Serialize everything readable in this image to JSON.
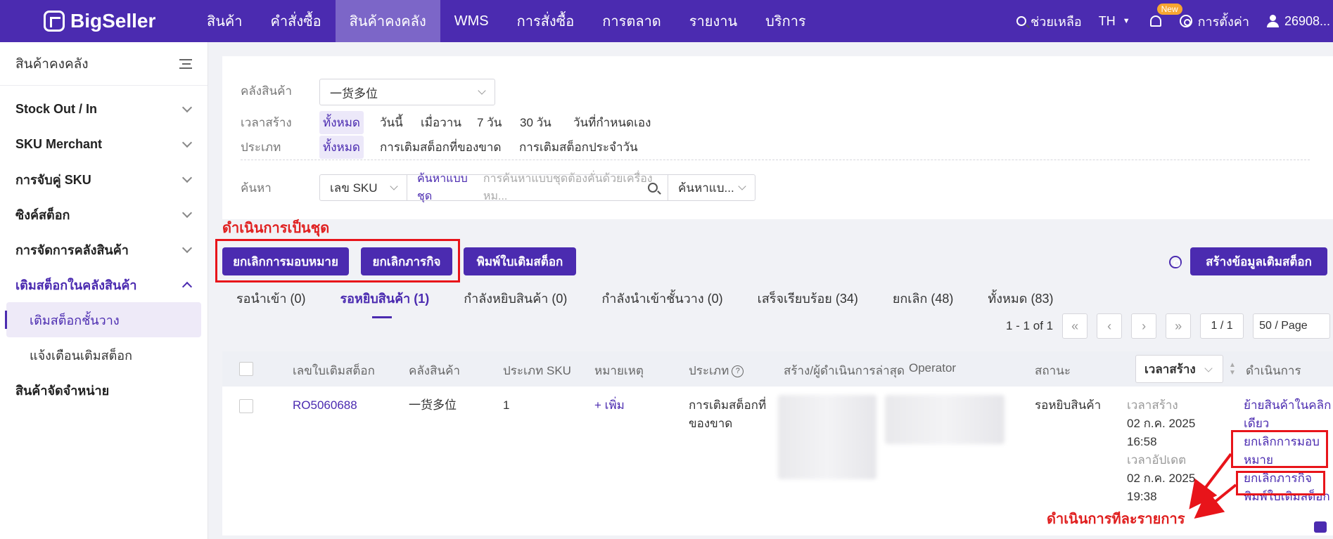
{
  "topbar": {
    "logo": "BigSeller",
    "nav": [
      "สินค้า",
      "คำสั่งซื้อ",
      "สินค้าคงคลัง",
      "WMS",
      "การสั่งซื้อ",
      "การตลาด",
      "รายงาน",
      "บริการ"
    ],
    "help": "ช่วยเหลือ",
    "lang": "TH",
    "new_badge": "New",
    "settings": "การตั้งค่า",
    "user": "26908..."
  },
  "sidebar": {
    "title": "สินค้าคงคลัง",
    "groups": [
      "Stock Out / In",
      "SKU Merchant",
      "การจับคู่ SKU",
      "ซิงค์สต็อก",
      "การจัดการคลังสินค้า",
      "เติมสต็อกในคลังสินค้า"
    ],
    "subitems": [
      "เติมสต็อกชั้นวาง",
      "แจ้งเตือนเติมสต็อก"
    ],
    "last_group": "สินค้าจัดจำหน่าย"
  },
  "filter": {
    "warehouse_label": "คลังสินค้า",
    "warehouse_value": "一货多位",
    "time_label": "เวลาสร้าง",
    "time_options": [
      "ทั้งหมด",
      "วันนี้",
      "เมื่อวาน",
      "7 วัน",
      "30 วัน",
      "วันที่กำหนดเอง"
    ],
    "type_label": "ประเภท",
    "type_options": [
      "ทั้งหมด",
      "การเติมสต็อกที่ของขาด",
      "การเติมสต็อกประจำวัน"
    ],
    "search_label": "ค้นหา",
    "search_field": "เลข SKU",
    "search_mode": "ค้นหาแบบชุด",
    "search_placeholder": "การค้นหาแบบชุดต้องคั่นด้วยเครื่องหม...",
    "search_scope": "ค้นหาแบ..."
  },
  "batch_label": "ดำเนินการเป็นชุด",
  "buttons": {
    "cancel_assign": "ยกเลิกการมอบหมาย",
    "cancel_task": "ยกเลิกภารกิจ",
    "print": "พิมพ์ใบเติมสต็อก",
    "create": "สร้างข้อมูลเติมสต็อก"
  },
  "tabs": [
    "รอนำเข้า (0)",
    "รอหยิบสินค้า (1)",
    "กำลังหยิบสินค้า (0)",
    "กำลังนำเข้าชั้นวาง (0)",
    "เสร็จเรียบร้อย (34)",
    "ยกเลิก (48)",
    "ทั้งหมด (83)"
  ],
  "pager": {
    "range": "1 - 1 of 1",
    "page": "1 / 1",
    "size": "50 / Page"
  },
  "table": {
    "headers": [
      "เลขใบเติมสต็อก",
      "คลังสินค้า",
      "ประเภท SKU",
      "หมายเหตุ",
      "ประเภท",
      "สร้าง/ผู้ดำเนินการล่าสุด",
      "Operator",
      "สถานะ",
      "เวลาสร้าง",
      "ดำเนินการ"
    ],
    "row": {
      "id": "RO5060688",
      "warehouse": "一货多位",
      "sku_type": "1",
      "note": "+ เพิ่ม",
      "type": "การเติมสต็อกที่ของขาด",
      "status": "รอหยิบสินค้า",
      "created_label": "เวลาสร้าง",
      "created_date": "02 ก.ค. 2025",
      "created_time": "16:58",
      "updated_label": "เวลาอัปเดต",
      "updated_date": "02 ก.ค. 2025",
      "updated_time": "19:38",
      "actions": [
        "ย้ายสินค้าในคลิกเดียว",
        "ยกเลิกการมอบหมาย",
        "ยกเลิกภารกิจ",
        "พิมพ์ใบเติมสต็อก"
      ]
    }
  },
  "annotation_single": "ดำเนินการทีละรายการ",
  "colors": {
    "brand": "#4b2bb0",
    "annotation": "#e02020"
  }
}
